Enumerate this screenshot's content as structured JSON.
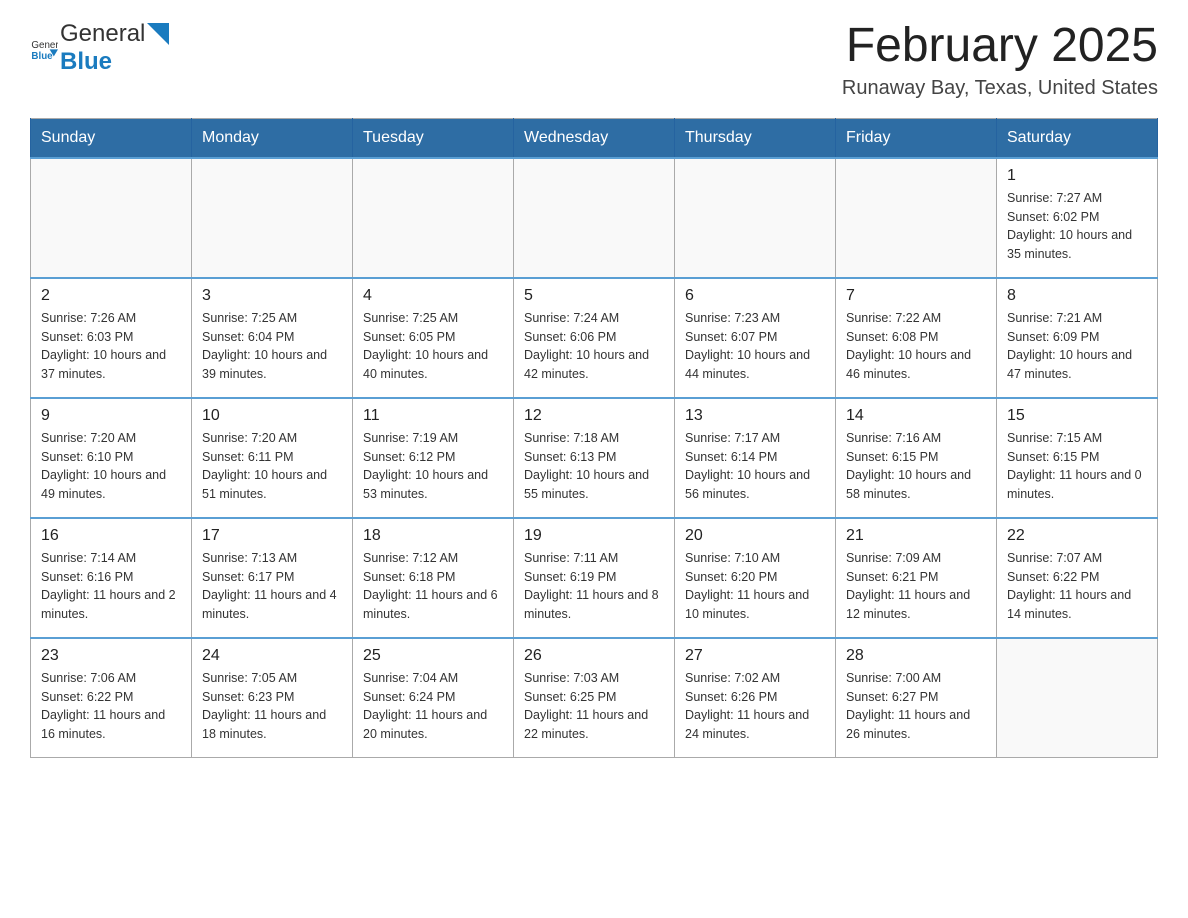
{
  "header": {
    "logo_general": "General",
    "logo_blue": "Blue",
    "month_title": "February 2025",
    "location": "Runaway Bay, Texas, United States"
  },
  "days_of_week": [
    "Sunday",
    "Monday",
    "Tuesday",
    "Wednesday",
    "Thursday",
    "Friday",
    "Saturday"
  ],
  "weeks": [
    [
      {
        "day": "",
        "info": ""
      },
      {
        "day": "",
        "info": ""
      },
      {
        "day": "",
        "info": ""
      },
      {
        "day": "",
        "info": ""
      },
      {
        "day": "",
        "info": ""
      },
      {
        "day": "",
        "info": ""
      },
      {
        "day": "1",
        "info": "Sunrise: 7:27 AM\nSunset: 6:02 PM\nDaylight: 10 hours and 35 minutes."
      }
    ],
    [
      {
        "day": "2",
        "info": "Sunrise: 7:26 AM\nSunset: 6:03 PM\nDaylight: 10 hours and 37 minutes."
      },
      {
        "day": "3",
        "info": "Sunrise: 7:25 AM\nSunset: 6:04 PM\nDaylight: 10 hours and 39 minutes."
      },
      {
        "day": "4",
        "info": "Sunrise: 7:25 AM\nSunset: 6:05 PM\nDaylight: 10 hours and 40 minutes."
      },
      {
        "day": "5",
        "info": "Sunrise: 7:24 AM\nSunset: 6:06 PM\nDaylight: 10 hours and 42 minutes."
      },
      {
        "day": "6",
        "info": "Sunrise: 7:23 AM\nSunset: 6:07 PM\nDaylight: 10 hours and 44 minutes."
      },
      {
        "day": "7",
        "info": "Sunrise: 7:22 AM\nSunset: 6:08 PM\nDaylight: 10 hours and 46 minutes."
      },
      {
        "day": "8",
        "info": "Sunrise: 7:21 AM\nSunset: 6:09 PM\nDaylight: 10 hours and 47 minutes."
      }
    ],
    [
      {
        "day": "9",
        "info": "Sunrise: 7:20 AM\nSunset: 6:10 PM\nDaylight: 10 hours and 49 minutes."
      },
      {
        "day": "10",
        "info": "Sunrise: 7:20 AM\nSunset: 6:11 PM\nDaylight: 10 hours and 51 minutes."
      },
      {
        "day": "11",
        "info": "Sunrise: 7:19 AM\nSunset: 6:12 PM\nDaylight: 10 hours and 53 minutes."
      },
      {
        "day": "12",
        "info": "Sunrise: 7:18 AM\nSunset: 6:13 PM\nDaylight: 10 hours and 55 minutes."
      },
      {
        "day": "13",
        "info": "Sunrise: 7:17 AM\nSunset: 6:14 PM\nDaylight: 10 hours and 56 minutes."
      },
      {
        "day": "14",
        "info": "Sunrise: 7:16 AM\nSunset: 6:15 PM\nDaylight: 10 hours and 58 minutes."
      },
      {
        "day": "15",
        "info": "Sunrise: 7:15 AM\nSunset: 6:15 PM\nDaylight: 11 hours and 0 minutes."
      }
    ],
    [
      {
        "day": "16",
        "info": "Sunrise: 7:14 AM\nSunset: 6:16 PM\nDaylight: 11 hours and 2 minutes."
      },
      {
        "day": "17",
        "info": "Sunrise: 7:13 AM\nSunset: 6:17 PM\nDaylight: 11 hours and 4 minutes."
      },
      {
        "day": "18",
        "info": "Sunrise: 7:12 AM\nSunset: 6:18 PM\nDaylight: 11 hours and 6 minutes."
      },
      {
        "day": "19",
        "info": "Sunrise: 7:11 AM\nSunset: 6:19 PM\nDaylight: 11 hours and 8 minutes."
      },
      {
        "day": "20",
        "info": "Sunrise: 7:10 AM\nSunset: 6:20 PM\nDaylight: 11 hours and 10 minutes."
      },
      {
        "day": "21",
        "info": "Sunrise: 7:09 AM\nSunset: 6:21 PM\nDaylight: 11 hours and 12 minutes."
      },
      {
        "day": "22",
        "info": "Sunrise: 7:07 AM\nSunset: 6:22 PM\nDaylight: 11 hours and 14 minutes."
      }
    ],
    [
      {
        "day": "23",
        "info": "Sunrise: 7:06 AM\nSunset: 6:22 PM\nDaylight: 11 hours and 16 minutes."
      },
      {
        "day": "24",
        "info": "Sunrise: 7:05 AM\nSunset: 6:23 PM\nDaylight: 11 hours and 18 minutes."
      },
      {
        "day": "25",
        "info": "Sunrise: 7:04 AM\nSunset: 6:24 PM\nDaylight: 11 hours and 20 minutes."
      },
      {
        "day": "26",
        "info": "Sunrise: 7:03 AM\nSunset: 6:25 PM\nDaylight: 11 hours and 22 minutes."
      },
      {
        "day": "27",
        "info": "Sunrise: 7:02 AM\nSunset: 6:26 PM\nDaylight: 11 hours and 24 minutes."
      },
      {
        "day": "28",
        "info": "Sunrise: 7:00 AM\nSunset: 6:27 PM\nDaylight: 11 hours and 26 minutes."
      },
      {
        "day": "",
        "info": ""
      }
    ]
  ]
}
